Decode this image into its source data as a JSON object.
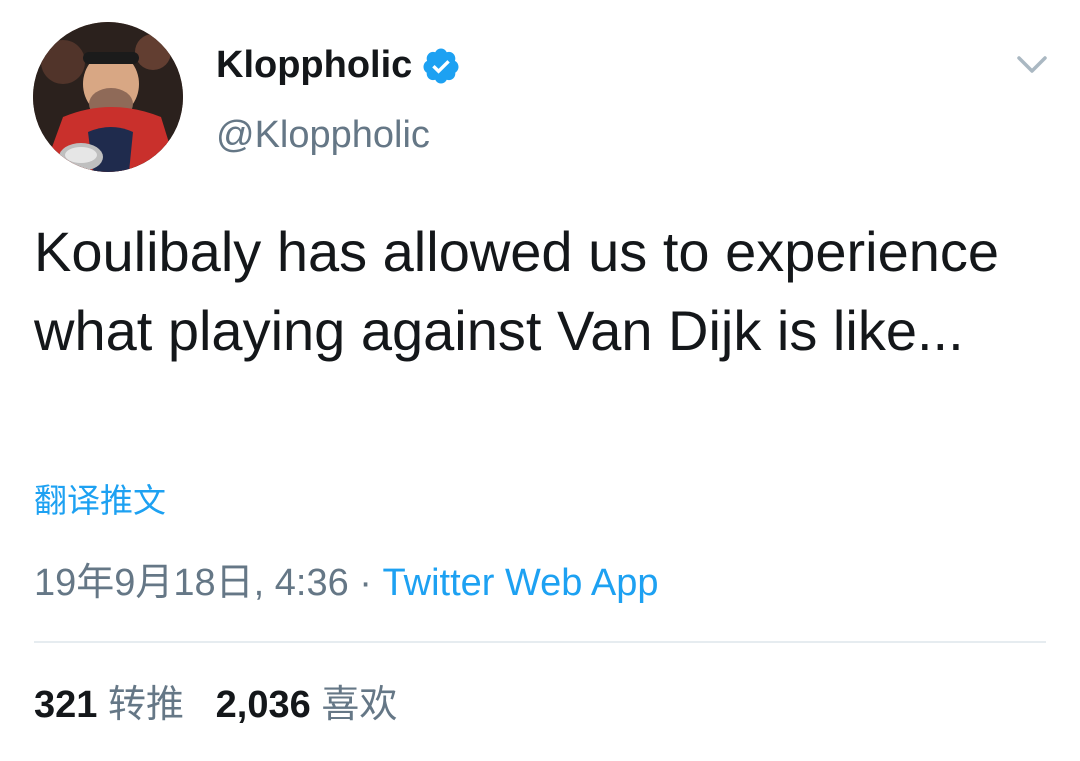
{
  "author": {
    "display_name": "Kloppholic",
    "handle": "@Kloppholic",
    "verified": true,
    "avatar_icon": "avatar-photo"
  },
  "tweet": {
    "text": "Koulibaly has allowed us to experience what playing against Van Dijk is like..."
  },
  "translate_label": "翻译推文",
  "meta": {
    "timestamp": "19年9月18日, 4:36",
    "separator": " · ",
    "source": "Twitter Web App"
  },
  "stats": {
    "retweets_count": "321",
    "retweets_label": "转推",
    "likes_count": "2,036",
    "likes_label": "喜欢"
  },
  "colors": {
    "accent": "#1da1f2",
    "text": "#14171a",
    "secondary": "#657786",
    "divider": "#e6ecf0"
  }
}
